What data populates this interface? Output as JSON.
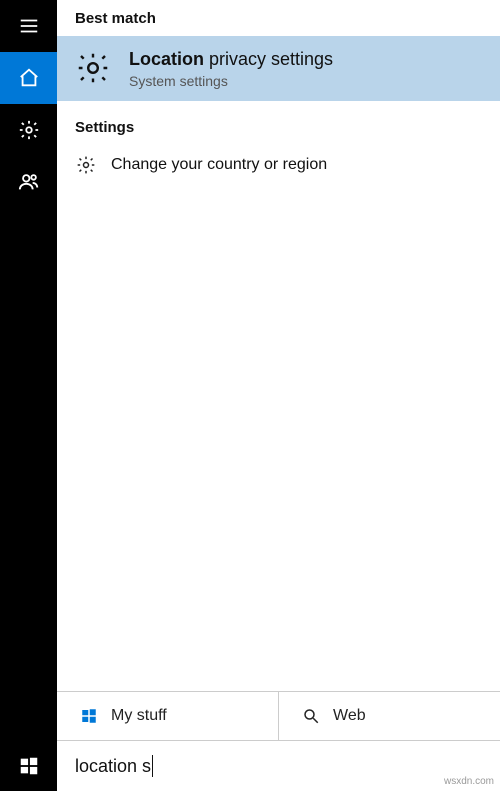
{
  "sidebar": {
    "items": [
      {
        "name": "hamburger-icon",
        "icon": "menu"
      },
      {
        "name": "home-icon",
        "icon": "home",
        "active": true
      },
      {
        "name": "settings-icon",
        "icon": "gear"
      },
      {
        "name": "people-icon",
        "icon": "people"
      }
    ]
  },
  "best_match": {
    "header": "Best match",
    "title_bold": "Location",
    "title_rest": " privacy settings",
    "subtitle": "System settings"
  },
  "settings": {
    "header": "Settings",
    "items": [
      {
        "label": "Change your country or region"
      }
    ]
  },
  "scope": {
    "my_stuff": "My stuff",
    "web": "Web"
  },
  "search": {
    "value": "location s"
  },
  "watermark": "wsxdn.com"
}
